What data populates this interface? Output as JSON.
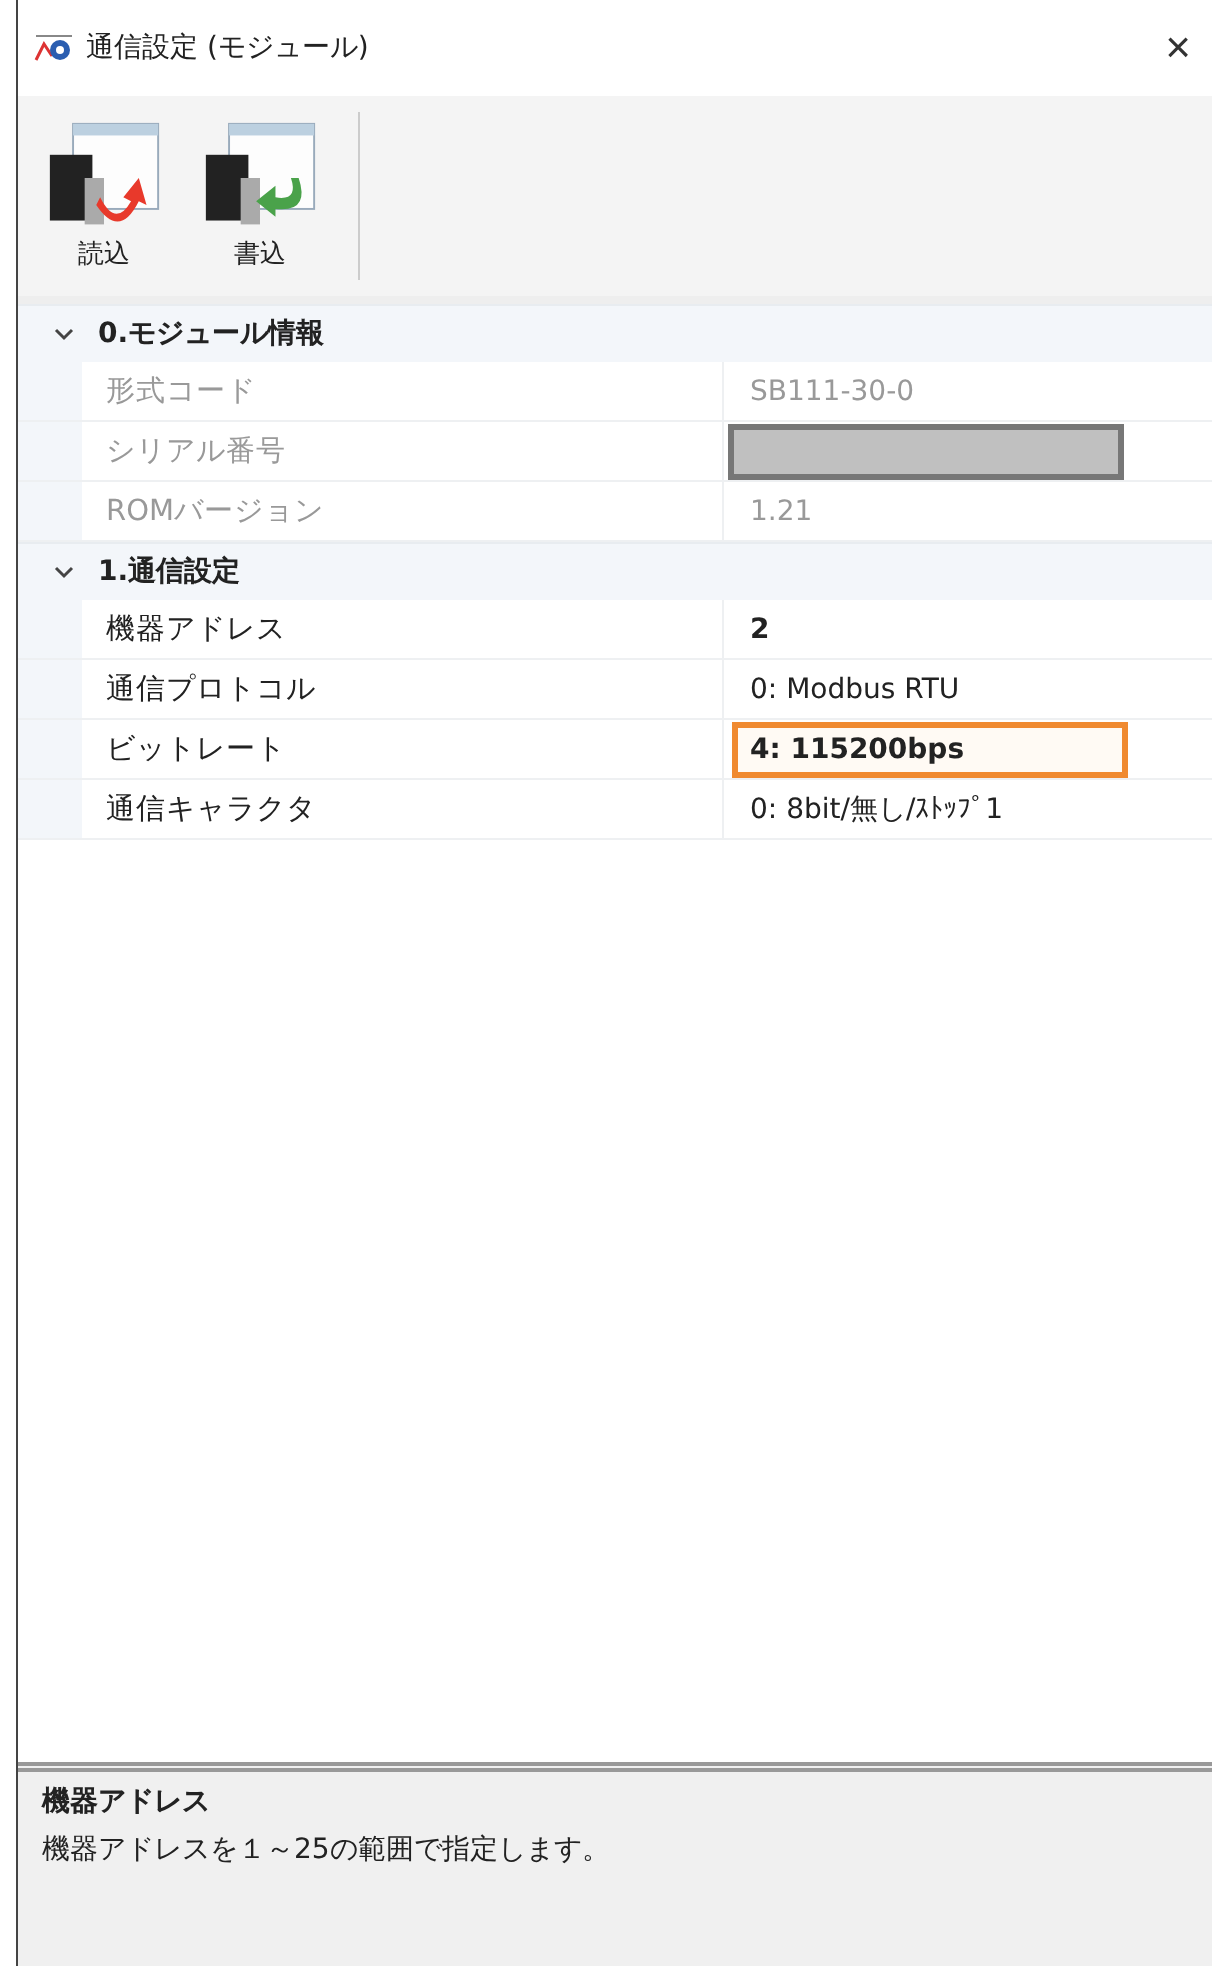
{
  "window": {
    "title": "通信設定 (モジュール)",
    "close": "×"
  },
  "toolbar": [
    {
      "label": "読込",
      "kind": "read"
    },
    {
      "label": "書込",
      "kind": "write"
    }
  ],
  "categories": [
    {
      "title": "0.モジュール情報",
      "expanded": true,
      "rows": [
        {
          "name": "形式コード",
          "value": "SB111-30-0",
          "readonly": true,
          "bold": false,
          "selected": false
        },
        {
          "name": "シリアル番号",
          "kind": "redacted",
          "readonly": true,
          "selected": false
        },
        {
          "name": "ROMバージョン",
          "value": "1.21",
          "readonly": true,
          "bold": false,
          "selected": false
        }
      ]
    },
    {
      "title": "1.通信設定",
      "expanded": true,
      "rows": [
        {
          "name": "機器アドレス",
          "value": "2",
          "readonly": false,
          "bold": true,
          "selected": false
        },
        {
          "name": "通信プロトコル",
          "value": "0: Modbus RTU",
          "readonly": false,
          "bold": false,
          "selected": false
        },
        {
          "name": "ビットレート",
          "value": "4: 115200bps",
          "readonly": false,
          "bold": true,
          "selected": true
        },
        {
          "name": "通信キャラクタ",
          "value": "0: 8bit/無し/ｽﾄｯﾌﾟ1",
          "readonly": false,
          "bold": false,
          "selected": false
        }
      ]
    }
  ],
  "description": {
    "title": "機器アドレス",
    "text": "機器アドレスを１～25の範囲で指定します。"
  }
}
